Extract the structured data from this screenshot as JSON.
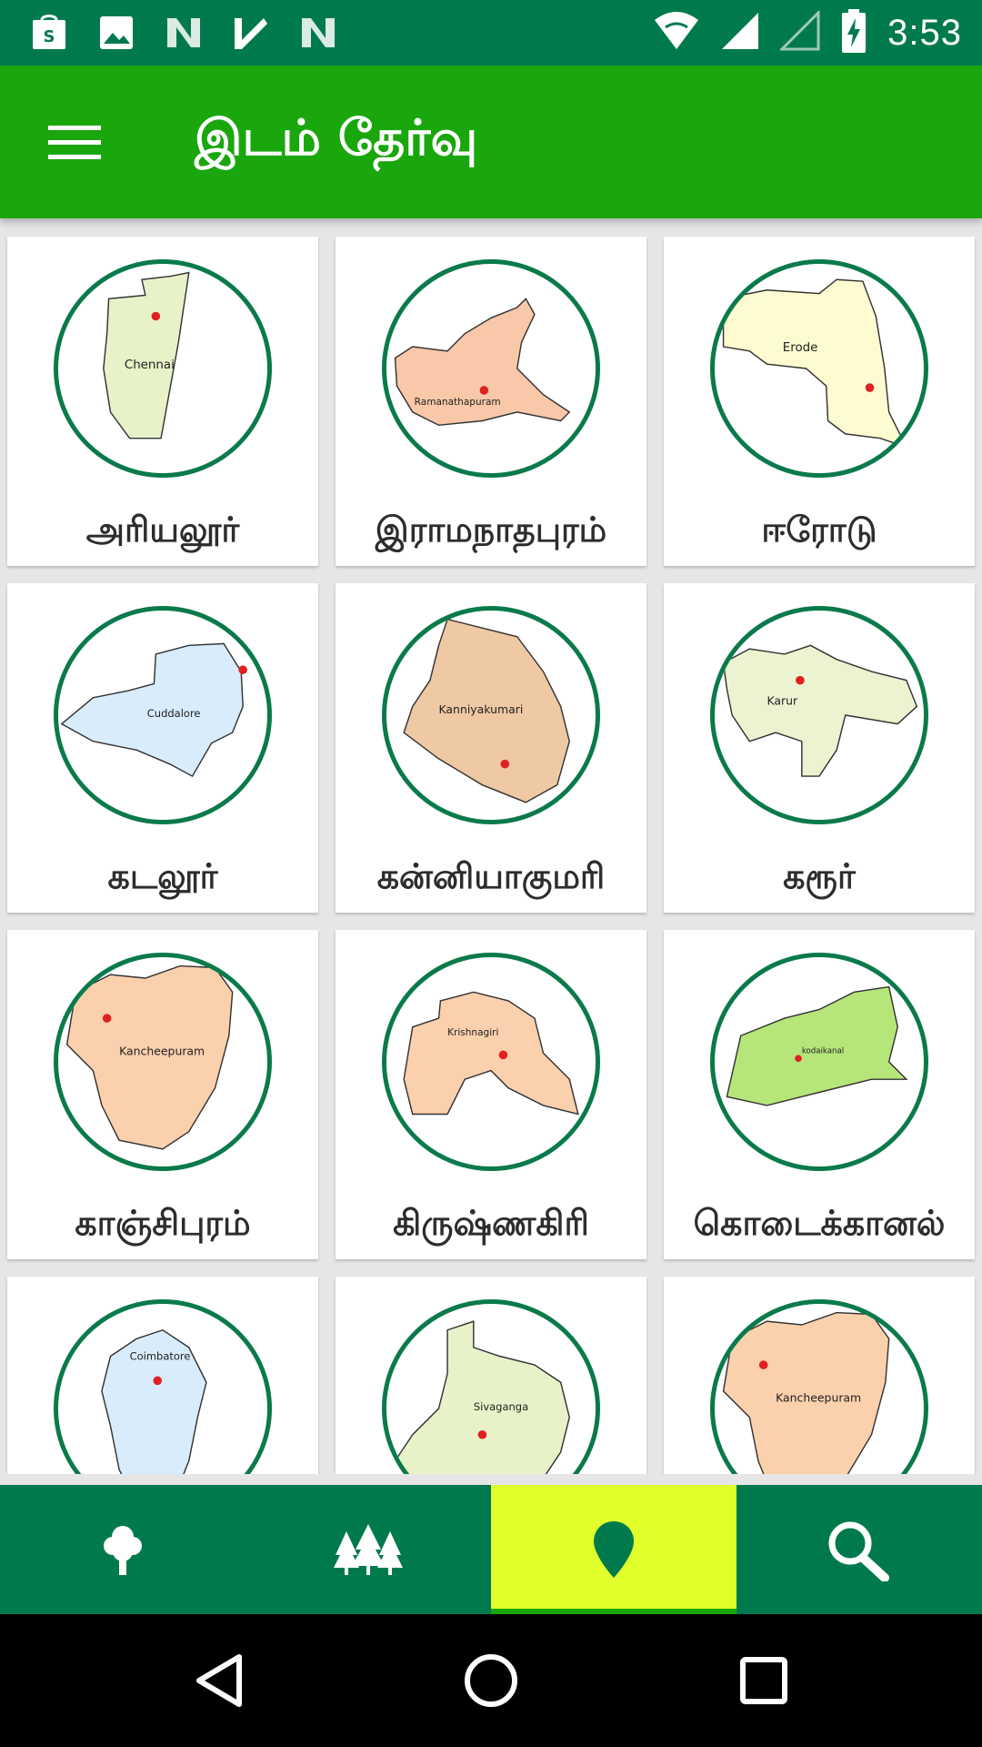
{
  "status_bar": {
    "time": "3:53",
    "icons": [
      "shopping-bag-icon",
      "image-icon",
      "n-icon",
      "check-icon",
      "n-icon",
      "wifi-icon",
      "signal-icon",
      "signal-empty-icon",
      "battery-charging-icon"
    ]
  },
  "app_bar": {
    "title": "இடம் தேர்வு",
    "menu_icon": "hamburger-menu-icon"
  },
  "districts": [
    {
      "label": "அரியலூர்",
      "map_text": "Chennai",
      "fill": "#e8f2c8"
    },
    {
      "label": "இராமநாதபுரம்",
      "map_text": "Ramanathapuram",
      "fill": "#f8c8a8"
    },
    {
      "label": "ஈரோடு",
      "map_text": "Erode",
      "fill": "#fffbd0"
    },
    {
      "label": "கடலூர்",
      "map_text": "Cuddalore",
      "fill": "#d8ecfb"
    },
    {
      "label": "கன்னியாகுமரி",
      "map_text": "Kanniyakumari",
      "fill": "#efc8a4"
    },
    {
      "label": "கரூர்",
      "map_text": "Karur",
      "fill": "#ecf3d0"
    },
    {
      "label": "காஞ்சிபுரம்",
      "map_text": "Kancheepuram",
      "fill": "#fbd0ad"
    },
    {
      "label": "கிருஷ்ணகிரி",
      "map_text": "Krishnagiri",
      "fill": "#fbd0ad"
    },
    {
      "label": "கொடைக்கானல்",
      "map_text": "kodaikanal",
      "fill": "#b6e67a"
    },
    {
      "label": "",
      "map_text": "Coimbatore",
      "fill": "#d8ecfb"
    },
    {
      "label": "",
      "map_text": "Sivaganga",
      "fill": "#e8f2c8"
    },
    {
      "label": "",
      "map_text": "Kancheepuram",
      "fill": "#fbd0ad"
    }
  ],
  "bottom_nav": [
    {
      "icon": "tree-icon",
      "active": false
    },
    {
      "icon": "forest-icon",
      "active": false
    },
    {
      "icon": "location-pin-icon",
      "active": true
    },
    {
      "icon": "search-icon",
      "active": false
    }
  ],
  "colors": {
    "status_bar": "#007a4d",
    "app_bar": "#1aa70e",
    "circle_border": "#0b7a4a",
    "active_nav": "#e0ff2b",
    "marker": "#e02020"
  }
}
